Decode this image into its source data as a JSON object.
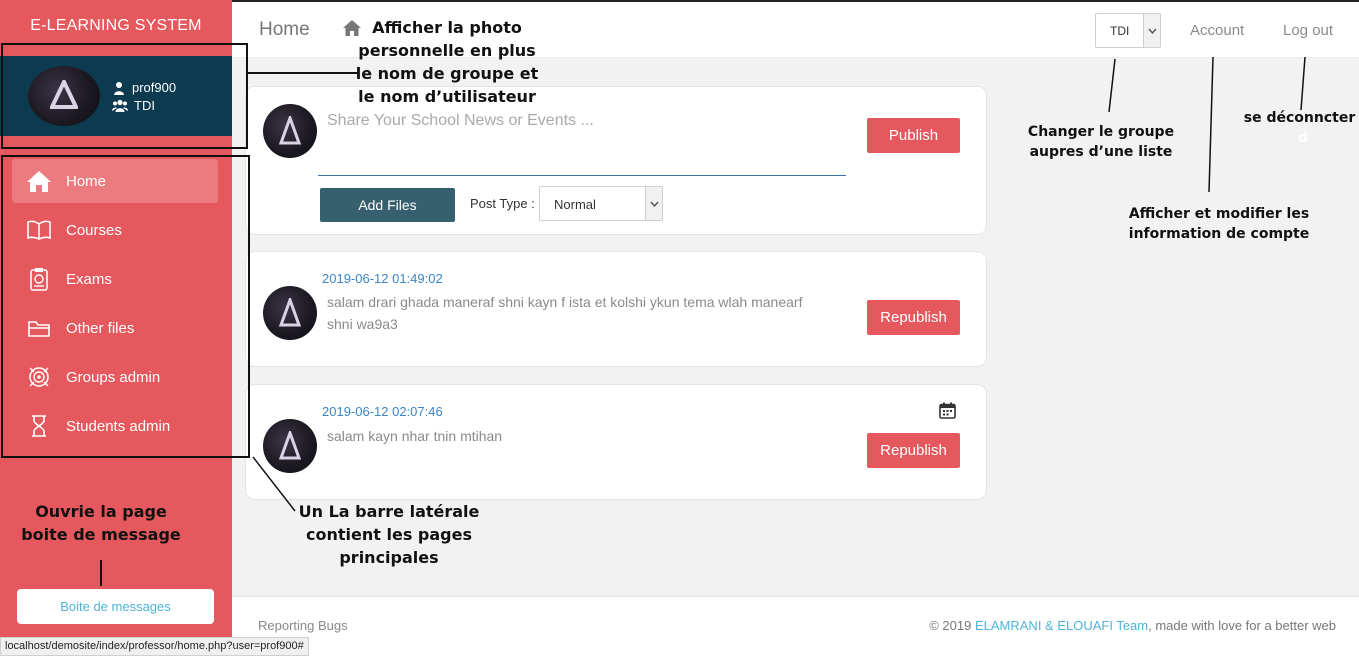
{
  "sidebar": {
    "brand": "E-LEARNING SYSTEM",
    "user": {
      "name": "prof900",
      "group": "TDI"
    },
    "items": [
      {
        "label": "Home",
        "icon": "home-icon",
        "active": true
      },
      {
        "label": "Courses",
        "icon": "book-icon",
        "active": false
      },
      {
        "label": "Exams",
        "icon": "exam-icon",
        "active": false
      },
      {
        "label": "Other files",
        "icon": "folder-icon",
        "active": false
      },
      {
        "label": "Groups admin",
        "icon": "groups-icon",
        "active": false
      },
      {
        "label": "Students admin",
        "icon": "student-icon",
        "active": false
      }
    ],
    "messages_button": "Boite de messages"
  },
  "header": {
    "title": "Home",
    "group_select": "TDI",
    "account": "Account",
    "logout": "Log out"
  },
  "composer": {
    "placeholder": "Share Your School News or Events ...",
    "publish": "Publish",
    "add_files": "Add Files",
    "post_type_label": "Post Type :",
    "post_type_value": "Normal"
  },
  "posts": [
    {
      "date": "2019-06-12 01:49:02",
      "text": "salam drari ghada maneraf shni kayn f ista et kolshi ykun tema wlah manearf shni wa9a3",
      "action": "Republish"
    },
    {
      "date": "2019-06-12 02:07:46",
      "text": "salam kayn nhar tnin mtihan",
      "action": "Republish"
    }
  ],
  "footer": {
    "left": "Reporting Bugs",
    "copyright": "© 2019 ",
    "team": "ELAMRANI & ELOUAFI Team",
    "suffix": ", made with love for a better web"
  },
  "status_url": "localhost/demosite/index/professor/home.php?user=prof900#",
  "annotations": {
    "profile": "Afficher la photo personnelle en plus le nom de groupe et le nom d’utilisateur",
    "sidebar": "Un La barre latérale contient les pages principales",
    "messages": "Ouvrie la  page boite de message",
    "group": "Changer le groupe aupres d’une liste",
    "account": "Afficher et modifier les information de compte",
    "logout": "se déconncter",
    "logout_tail": "d"
  },
  "colors": {
    "sidebar": "#e5585d",
    "profile_bg": "#0c3a4e",
    "accent_red": "#e5585d",
    "accent_blue": "#37606e",
    "link": "#4fb3d9"
  }
}
